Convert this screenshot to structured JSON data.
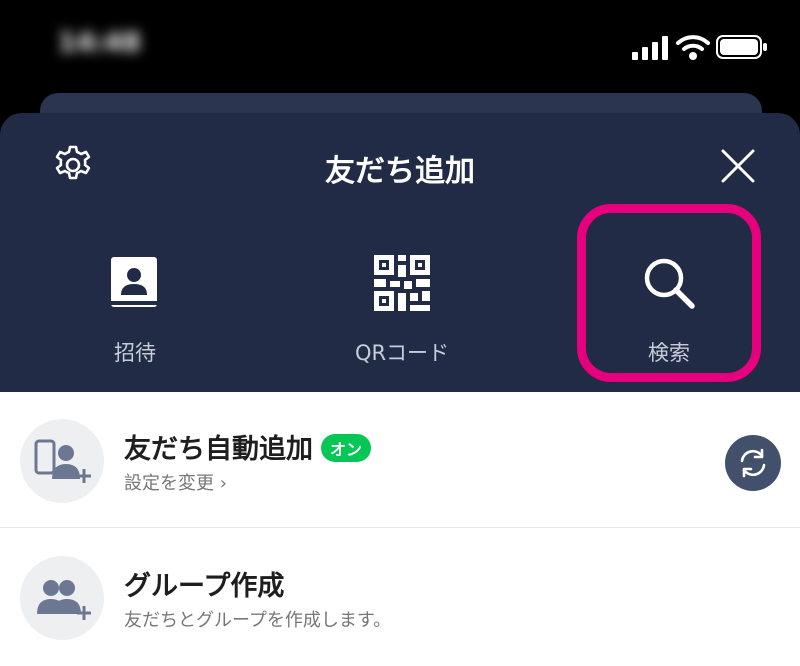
{
  "status": {
    "time": "14:48"
  },
  "header": {
    "title": "友だち追加"
  },
  "actions": [
    {
      "label": "招待",
      "icon": "contacts-book-icon"
    },
    {
      "label": "QRコード",
      "icon": "qr-code-icon"
    },
    {
      "label": "検索",
      "icon": "search-icon"
    }
  ],
  "list": {
    "auto_add": {
      "title": "友だち自動追加",
      "badge": "オン",
      "subtitle": "設定を変更 ›"
    },
    "group": {
      "title": "グループ作成",
      "subtitle": "友だちとグループを作成します。"
    }
  },
  "colors": {
    "sheet": "#222b45",
    "highlight": "#e6007e",
    "badge": "#06c755"
  }
}
